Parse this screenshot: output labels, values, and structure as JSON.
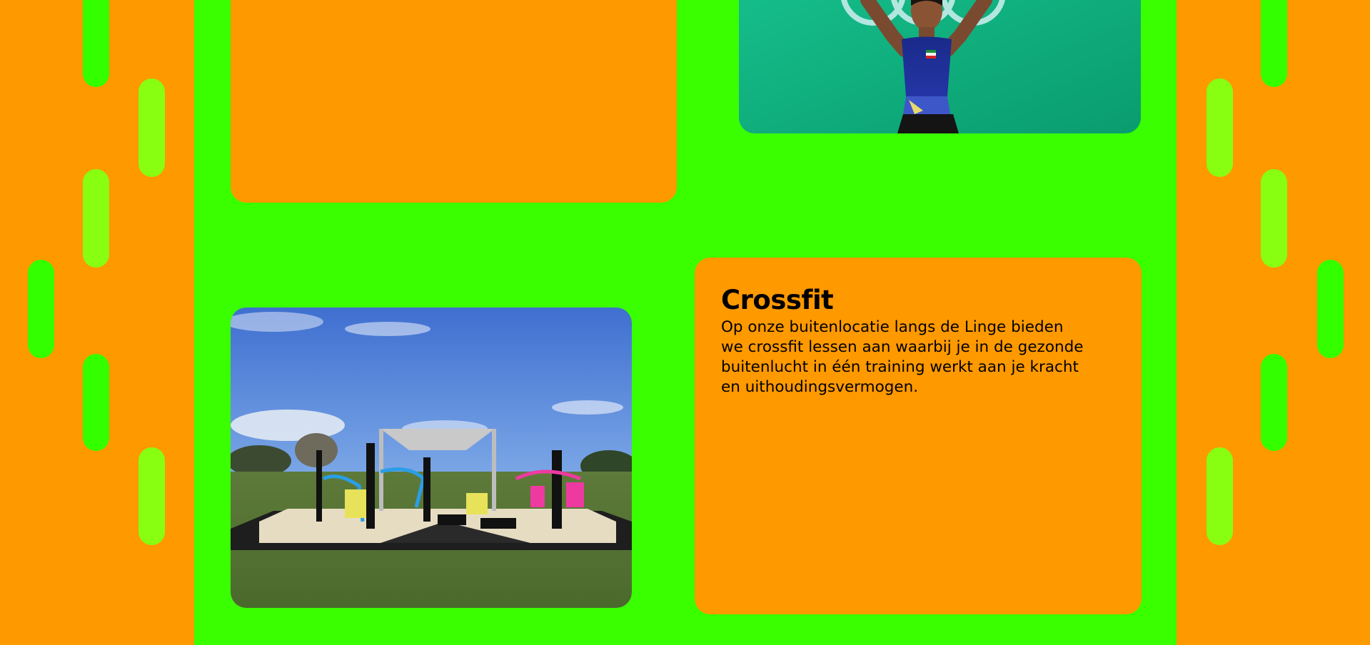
{
  "colors": {
    "outer_bg": "#ff9900",
    "center_bg": "#39ff00",
    "card_bg": "#ff9900",
    "pill_green": "#33ff00",
    "pill_lime": "#88ff11"
  },
  "images": {
    "top_right": "weightlifter-photo",
    "crossfit": "outdoor-fitness-park-photo"
  },
  "sections": {
    "crossfit": {
      "title": "Crossfit",
      "description": "Op onze buitenlocatie langs de Linge bieden we crossfit lessen aan waarbij je in de gezonde buitenlucht in één training werkt aan je kracht en uithoudingsvermogen."
    }
  }
}
